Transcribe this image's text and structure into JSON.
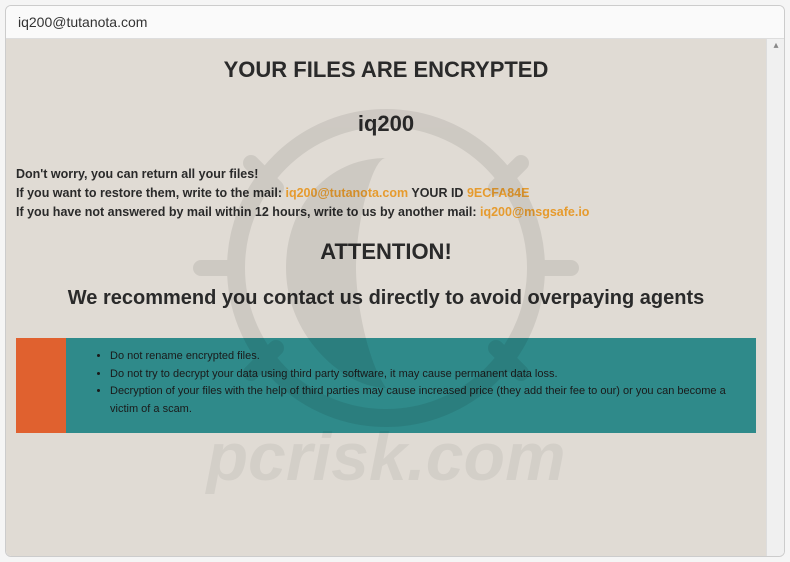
{
  "window": {
    "title": "iq200@tutanota.com"
  },
  "headings": {
    "main": "YOUR FILES ARE ENCRYPTED",
    "name": "iq200",
    "attention": "ATTENTION!",
    "recommend": "We recommend you contact us directly to avoid overpaying agents"
  },
  "body": {
    "line1": "Don't worry, you can return all your files!",
    "line2_prefix": "If you want to restore them, write to the mail:   ",
    "email1": "iq200@tutanota.com",
    "line2_mid": "   YOUR ID ",
    "your_id": "9ECFA84E",
    "line3_prefix": "If you have not answered by mail within 12 hours, write to us by another mail:  ",
    "email2": "iq200@msgsafe.io"
  },
  "warnings": [
    "Do not rename encrypted files.",
    "Do not try to decrypt your data using third party software, it may cause permanent data loss.",
    "Decryption of your files with the help of third parties may cause increased price (they add their fee to our) or you can become a victim of a scam."
  ],
  "watermark": {
    "text": "pcrisk.com"
  }
}
